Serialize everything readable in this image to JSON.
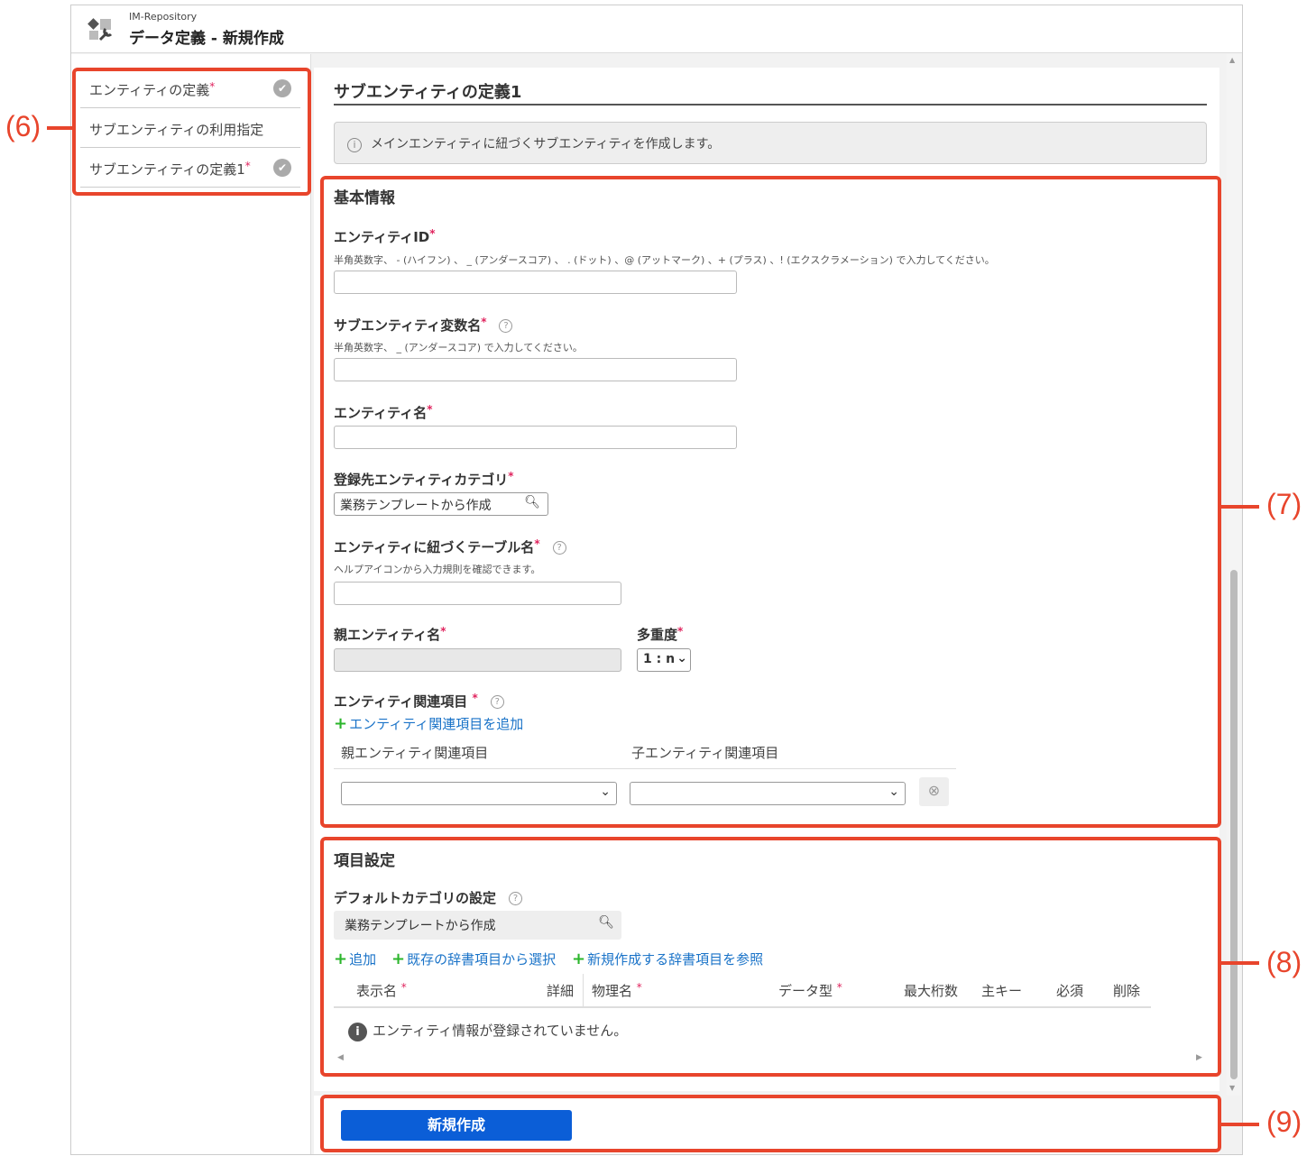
{
  "header": {
    "app": "IM-Repository",
    "title": "データ定義 - 新規作成",
    "logo_icon": "repository-wrench-icon"
  },
  "sidebar": {
    "items": [
      {
        "label": "エンティティの定義",
        "required": "*",
        "checked": true
      },
      {
        "label": "サブエンティティの利用指定",
        "checked": false
      },
      {
        "label": "サブエンティティの定義1",
        "required": "*",
        "checked": true
      }
    ]
  },
  "main": {
    "section_title": "サブエンティティの定義1",
    "info": "メインエンティティに紐づくサブエンティティを作成します。",
    "basic": {
      "title": "基本情報",
      "entity_id": {
        "label": "エンティティID",
        "hint": "半角英数字、 - (ハイフン) 、 _ (アンダースコア) 、 . (ドット) 、@ (アットマーク) 、+ (プラス) 、! (エクスクラメーション) で入力してください。",
        "value": ""
      },
      "var_name": {
        "label": "サブエンティティ変数名",
        "hint": "半角英数字、 _ (アンダースコア) で入力してください。",
        "value": ""
      },
      "entity_name": {
        "label": "エンティティ名",
        "value": ""
      },
      "category": {
        "label": "登録先エンティティカテゴリ",
        "value": "業務テンプレートから作成"
      },
      "table_name": {
        "label": "エンティティに紐づくテーブル名",
        "hint": "ヘルプアイコンから入力規則を確認できます。",
        "value": ""
      },
      "parent_name": {
        "label": "親エンティティ名",
        "value": ""
      },
      "multiplicity": {
        "label": "多重度",
        "value": "1 : n"
      },
      "relation": {
        "label": "エンティティ関連項目",
        "add": "エンティティ関連項目を追加",
        "col_parent": "親エンティティ関連項目",
        "col_child": "子エンティティ関連項目"
      }
    },
    "items": {
      "title": "項目設定",
      "default_category_label": "デフォルトカテゴリの設定",
      "default_category_value": "業務テンプレートから作成",
      "actions": [
        "追加",
        "既存の辞書項目から選択",
        "新規作成する辞書項目を参照"
      ],
      "columns": [
        "表示名",
        "詳細",
        "物理名",
        "データ型",
        "最大桁数",
        "主キー",
        "必須",
        "削除"
      ],
      "empty": "エンティティ情報が登録されていません。"
    }
  },
  "footer": {
    "create": "新規作成"
  },
  "annotations": [
    "(6)",
    "(7)",
    "(8)",
    "(9)"
  ],
  "required_mark": "*",
  "colors": {
    "accent": "#0b5ed7",
    "annotation": "#e8452c",
    "link": "#1a73c8",
    "plus": "#2bb52b"
  }
}
